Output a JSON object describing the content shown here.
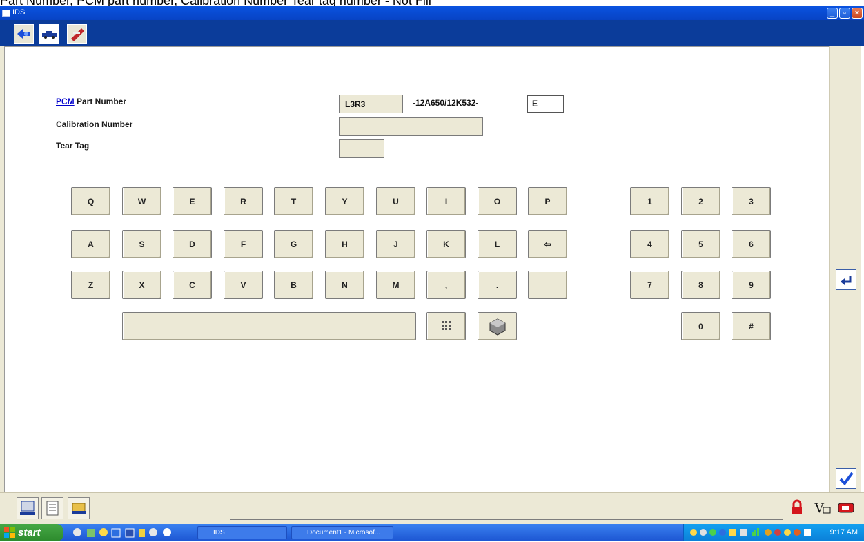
{
  "overlay_text": "Part Number, PCM part number, Calibration Number Tear tag number  - Not Fill",
  "window": {
    "title": "IDS"
  },
  "form": {
    "pcm_link": "PCM",
    "part_number_label": " Part Number",
    "calibration_label": "Calibration Number",
    "tear_tag_label": "Tear Tag",
    "prefix_value": "L3R3",
    "middle_text": "-12A650/12K532-",
    "suffix_value": "E",
    "calibration_value": "",
    "tear_tag_value": ""
  },
  "keyboard": {
    "row1": [
      "Q",
      "W",
      "E",
      "R",
      "T",
      "Y",
      "U",
      "I",
      "O",
      "P"
    ],
    "row2": [
      "A",
      "S",
      "D",
      "F",
      "G",
      "H",
      "J",
      "K",
      "L",
      "⇦"
    ],
    "row3": [
      "Z",
      "X",
      "C",
      "V",
      "B",
      "N",
      "M",
      ",",
      ".",
      "_"
    ],
    "numpad_row1": [
      "1",
      "2",
      "3"
    ],
    "numpad_row2": [
      "4",
      "5",
      "6"
    ],
    "numpad_row3": [
      "7",
      "8",
      "9"
    ],
    "numpad_row4": [
      "0",
      "#"
    ]
  },
  "taskbar": {
    "start_label": "start",
    "items": [
      "IDS",
      "Document1 - Microsof..."
    ],
    "clock": "9:17 AM"
  },
  "colors": {
    "titlebar": "#0a53e0",
    "toolbar": "#0b3c9a",
    "button_face": "#ece9d6",
    "accent_blue": "#0000cc"
  }
}
